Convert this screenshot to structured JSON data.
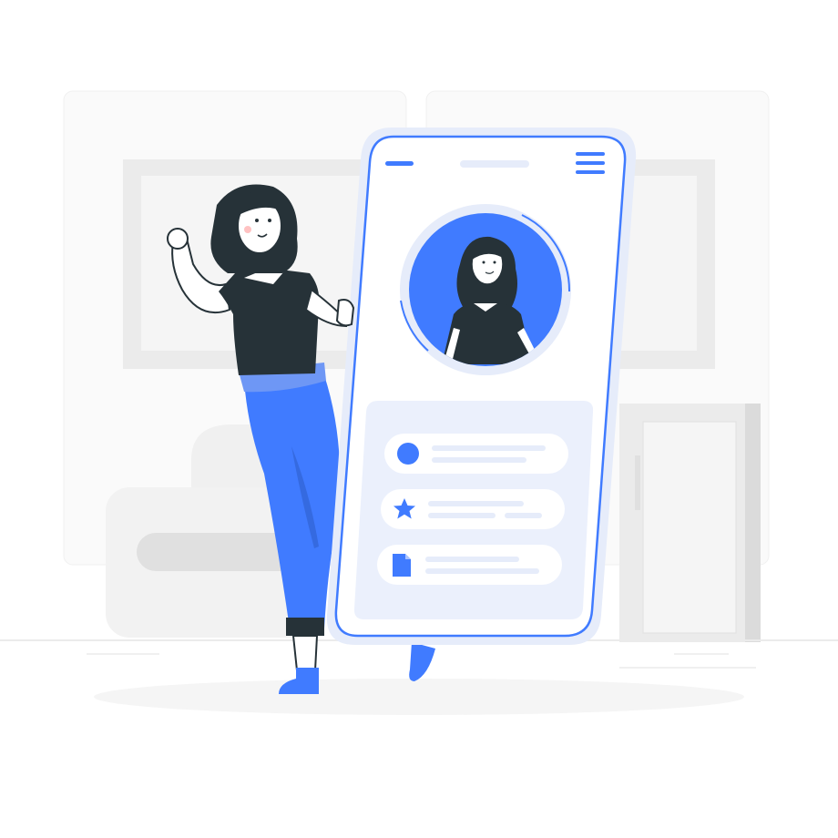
{
  "illustration": {
    "subject": "woman-standing-next-to-giant-phone-profile",
    "colors": {
      "accent": "#407BFF",
      "accent_light": "#E6ECFA",
      "card_bg": "#EBF0FC",
      "hair_shirt": "#263238",
      "skin": "#FFFFFF",
      "furniture": "#EBEBEB",
      "furniture_dark": "#DBDBDB",
      "wall_panel": "#FAFAFA",
      "floor_shadow": "#F5F5F5"
    }
  },
  "phone": {
    "top_bar": {
      "left_icon": "dash-icon",
      "center": "speaker-pill",
      "right_icon": "hamburger-menu-icon"
    },
    "profile_avatar": "woman-avatar",
    "list_items": [
      {
        "icon": "circle-icon"
      },
      {
        "icon": "star-icon"
      },
      {
        "icon": "document-icon"
      }
    ]
  }
}
